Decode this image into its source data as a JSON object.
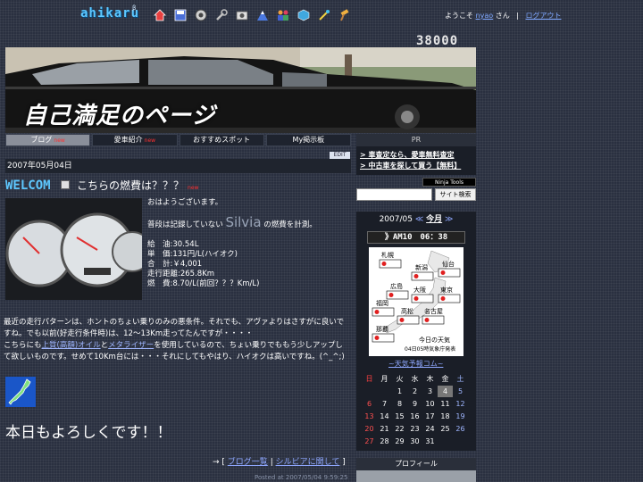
{
  "top_bar": {
    "brand": "ahikaru",
    "brand_sup": "β",
    "nav_icons": [
      "home-icon",
      "save-icon",
      "settings-icon",
      "tools-icon",
      "camera-icon",
      "mountain-icon",
      "people-icon",
      "cube-icon",
      "magic-icon",
      "hammer-icon"
    ],
    "welcome_prefix": "ようこそ",
    "username": "nyao",
    "welcome_suffix": "さん",
    "separator": "|",
    "logout": "ログアウト"
  },
  "counter": "38000",
  "header": {
    "site_title": "自己満足のページ"
  },
  "tabs": [
    {
      "label": "ブログ",
      "badge": "new",
      "active": true
    },
    {
      "label": "愛車紹介",
      "badge": "new",
      "active": false
    },
    {
      "label": "おすすめスポット",
      "badge": "",
      "active": false
    },
    {
      "label": "My掲示板",
      "badge": "",
      "active": false
    }
  ],
  "entry": {
    "edit": "EDIT",
    "date": "2007年05月04日",
    "category_logo": "WELCOM",
    "title": "こちらの燃費は？？？",
    "title_badge": "new",
    "line1": "おはようございます。",
    "line2_prefix": "普段は記録していない",
    "line2_name": "Silvia",
    "line2_suffix": "の燃費を計測。",
    "specs": [
      "給　油:30.54L",
      "単　価:131円/L(ハイオク)",
      "合　計:￥4,001",
      "走行距離:265.8Km",
      "燃　費:8.70/L(前回？？？Km/L)"
    ],
    "para1": "最近の走行パターンは、ホントのちょい乗りのみの悪条件。それでも、アヴァよりはさすがに良いですね。でも以前(好走行条件時)は、12～13Km走ってたんですが・・・・",
    "para2_a": "こちらにも",
    "para2_link1": "上質(高額)オイル",
    "para2_b": "と",
    "para2_link2": "メタライザー",
    "para2_c": "を使用しているので、ちょい乗りでももう少しアップして欲しいものです。せめて10Km台には・・・それにしてもやはり、ハイオクは高いですね。(^_^;)",
    "greeting": "本日もよろしくです！！",
    "links_prefix": "→ [",
    "link_list": "ブログ一覧",
    "link_sep": "|",
    "link_topic": "シルビアに関して",
    "links_suffix": "]",
    "posted": "Posted at 2007/05/04 9:59:25"
  },
  "sidebar": {
    "pr_title": "PR",
    "pr_links": [
      "> 車査定なら、愛車無料査定",
      "> 中古車を探して買う【無料】"
    ],
    "ninja": "Ninja Tools",
    "search_placeholder": "",
    "search_button": "サイト検索",
    "calendar_nav": {
      "prev": "≪",
      "month": "2007/05",
      "today": "今月",
      "next": "≫"
    },
    "weather": {
      "clock": "》AM10　06：38",
      "cities": [
        "札幌",
        "新潟",
        "仙台",
        "広島",
        "大阪",
        "東京",
        "福岡",
        "高松",
        "名古屋",
        "那覇"
      ],
      "caption1": "今日の天気",
      "caption2": "04日05時気象庁発表",
      "site": "~天気予報コム~"
    },
    "calendar": {
      "dow": [
        "日",
        "月",
        "火",
        "水",
        "木",
        "金",
        "土"
      ],
      "weeks": [
        [
          "",
          "",
          "1",
          "2",
          "3",
          "4",
          "5"
        ],
        [
          "6",
          "7",
          "8",
          "9",
          "10",
          "11",
          "12"
        ],
        [
          "13",
          "14",
          "15",
          "16",
          "17",
          "18",
          "19"
        ],
        [
          "20",
          "21",
          "22",
          "23",
          "24",
          "25",
          "26"
        ],
        [
          "27",
          "28",
          "29",
          "30",
          "31",
          "",
          ""
        ]
      ],
      "today": "4"
    },
    "profile_title": "プロフィール"
  }
}
